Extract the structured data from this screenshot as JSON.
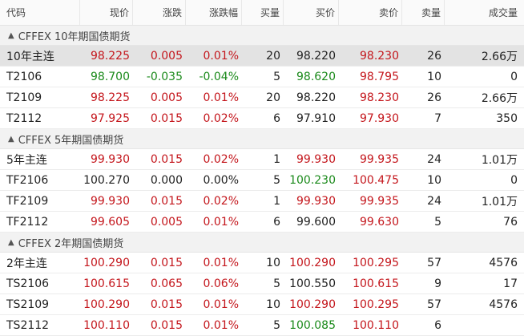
{
  "colors": {
    "up": "#c4161c",
    "down": "#1b8a1b",
    "flat": "#222222",
    "selected_row": "#e3e3e3"
  },
  "headers": [
    "代码",
    "现价",
    "涨跌",
    "涨跌幅",
    "买量",
    "买价",
    "卖价",
    "卖量",
    "成交量"
  ],
  "groups": [
    {
      "title": "CFFEX 10年期国债期货",
      "rows": [
        {
          "code": "10年主连",
          "price": "98.225",
          "change": "0.005",
          "pct": "0.01%",
          "bid_vol": "20",
          "bid": "98.220",
          "ask": "98.230",
          "ask_vol": "26",
          "volume": "2.66万",
          "dir": "up",
          "bid_dir": "flat",
          "ask_dir": "up",
          "selected": true
        },
        {
          "code": "T2106",
          "price": "98.700",
          "change": "-0.035",
          "pct": "-0.04%",
          "bid_vol": "5",
          "bid": "98.620",
          "ask": "98.795",
          "ask_vol": "10",
          "volume": "0",
          "dir": "down",
          "bid_dir": "down",
          "ask_dir": "up",
          "selected": false
        },
        {
          "code": "T2109",
          "price": "98.225",
          "change": "0.005",
          "pct": "0.01%",
          "bid_vol": "20",
          "bid": "98.220",
          "ask": "98.230",
          "ask_vol": "26",
          "volume": "2.66万",
          "dir": "up",
          "bid_dir": "flat",
          "ask_dir": "up",
          "selected": false
        },
        {
          "code": "T2112",
          "price": "97.925",
          "change": "0.015",
          "pct": "0.02%",
          "bid_vol": "6",
          "bid": "97.910",
          "ask": "97.930",
          "ask_vol": "7",
          "volume": "350",
          "dir": "up",
          "bid_dir": "flat",
          "ask_dir": "up",
          "selected": false
        }
      ]
    },
    {
      "title": "CFFEX 5年期国债期货",
      "rows": [
        {
          "code": "5年主连",
          "price": "99.930",
          "change": "0.015",
          "pct": "0.02%",
          "bid_vol": "1",
          "bid": "99.930",
          "ask": "99.935",
          "ask_vol": "24",
          "volume": "1.01万",
          "dir": "up",
          "bid_dir": "up",
          "ask_dir": "up",
          "selected": false
        },
        {
          "code": "TF2106",
          "price": "100.270",
          "change": "0.000",
          "pct": "0.00%",
          "bid_vol": "5",
          "bid": "100.230",
          "ask": "100.475",
          "ask_vol": "10",
          "volume": "0",
          "dir": "flat",
          "bid_dir": "down",
          "ask_dir": "up",
          "selected": false
        },
        {
          "code": "TF2109",
          "price": "99.930",
          "change": "0.015",
          "pct": "0.02%",
          "bid_vol": "1",
          "bid": "99.930",
          "ask": "99.935",
          "ask_vol": "24",
          "volume": "1.01万",
          "dir": "up",
          "bid_dir": "up",
          "ask_dir": "up",
          "selected": false
        },
        {
          "code": "TF2112",
          "price": "99.605",
          "change": "0.005",
          "pct": "0.01%",
          "bid_vol": "6",
          "bid": "99.600",
          "ask": "99.630",
          "ask_vol": "5",
          "volume": "76",
          "dir": "up",
          "bid_dir": "flat",
          "ask_dir": "up",
          "selected": false
        }
      ]
    },
    {
      "title": "CFFEX 2年期国债期货",
      "rows": [
        {
          "code": "2年主连",
          "price": "100.290",
          "change": "0.015",
          "pct": "0.01%",
          "bid_vol": "10",
          "bid": "100.290",
          "ask": "100.295",
          "ask_vol": "57",
          "volume": "4576",
          "dir": "up",
          "bid_dir": "up",
          "ask_dir": "up",
          "selected": false
        },
        {
          "code": "TS2106",
          "price": "100.615",
          "change": "0.065",
          "pct": "0.06%",
          "bid_vol": "5",
          "bid": "100.550",
          "ask": "100.615",
          "ask_vol": "9",
          "volume": "17",
          "dir": "up",
          "bid_dir": "flat",
          "ask_dir": "up",
          "selected": false
        },
        {
          "code": "TS2109",
          "price": "100.290",
          "change": "0.015",
          "pct": "0.01%",
          "bid_vol": "10",
          "bid": "100.290",
          "ask": "100.295",
          "ask_vol": "57",
          "volume": "4576",
          "dir": "up",
          "bid_dir": "up",
          "ask_dir": "up",
          "selected": false
        },
        {
          "code": "TS2112",
          "price": "100.110",
          "change": "0.015",
          "pct": "0.01%",
          "bid_vol": "5",
          "bid": "100.085",
          "ask": "100.110",
          "ask_vol": "6",
          "volume": "",
          "dir": "up",
          "bid_dir": "down",
          "ask_dir": "up",
          "selected": false
        }
      ]
    }
  ]
}
